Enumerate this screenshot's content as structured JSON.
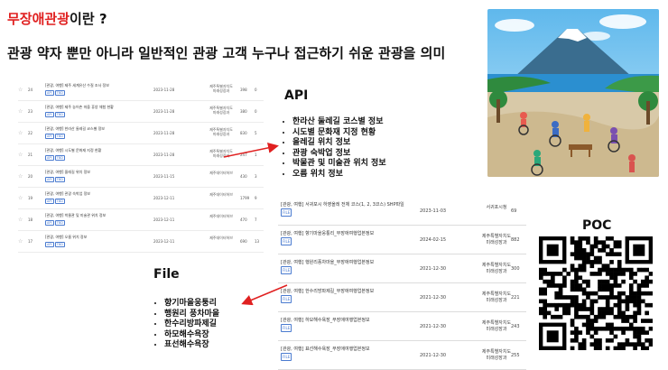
{
  "heading": {
    "highlight": "무장애관광",
    "rest": "이란 ?"
  },
  "subtitle": "관광 약자 뿐만 아니라 일반적인 관광 고객 누구나 접근하기 쉬운 관광을 의미",
  "api_label": "API",
  "api_items": [
    "한라산 둘레길 코스별 정보",
    "시도별 문화재 지정 현황",
    "올레길 위치 정보",
    "관광 숙박업 정보",
    "박물관 및 미술관 위치 정보",
    "오름 위치 정보"
  ],
  "file_label": "File",
  "file_items": [
    "향기마을웅퉁리",
    "행원리 풍차마을",
    "한수리방파제길",
    "하모해수욕장",
    "표선해수욕장"
  ],
  "poc_label": "POC",
  "api_table": [
    {
      "num": "24",
      "title": "[관광, 여행] 제주 세계유산 수질 조사 정보",
      "tags": [
        "API",
        "TBD"
      ],
      "date": "2023-11-28",
      "org1": "제주특별자치도",
      "org2": "미래성장과",
      "count": "398",
      "zero": "0"
    },
    {
      "num": "23",
      "title": "[관광, 여행] 제주 농어촌 마을 휴양 체험 현황",
      "tags": [
        "API",
        "TBD"
      ],
      "date": "2023-11-28",
      "org1": "제주특별자치도",
      "org2": "미래성장과",
      "count": "380",
      "zero": "0"
    },
    {
      "num": "22",
      "title": "[관광, 여행] 한라산 둘레길 코스별 정보",
      "tags": [
        "API",
        "TBD"
      ],
      "date": "2023-11-28",
      "org1": "제주특별자치도",
      "org2": "미래성장과",
      "count": "830",
      "zero": "5"
    },
    {
      "num": "21",
      "title": "[관광, 여행] 시도별 문화재 지정 현황",
      "tags": [
        "API",
        "TBD"
      ],
      "date": "2023-11-28",
      "org1": "제주특별자치도",
      "org2": "미래성장과",
      "count": "247",
      "zero": "1"
    },
    {
      "num": "20",
      "title": "[관광, 여행] 올레길 위치 정보",
      "tags": [
        "API",
        "TBD"
      ],
      "date": "2023-11-15",
      "org1": "제주데이터허브",
      "org2": "",
      "count": "430",
      "zero": "3"
    },
    {
      "num": "19",
      "title": "[관광, 여행] 관광 숙박업 정보",
      "tags": [
        "API",
        "TBD"
      ],
      "date": "2023-12-11",
      "org1": "제주데이터허브",
      "org2": "",
      "count": "1799",
      "zero": "9"
    },
    {
      "num": "18",
      "title": "[관광, 여행] 박물관 및 미술관 위치 정보",
      "tags": [
        "API",
        "TBD"
      ],
      "date": "2023-12-11",
      "org1": "제주데이터허브",
      "org2": "",
      "count": "470",
      "zero": "7"
    },
    {
      "num": "17",
      "title": "[관광, 여행] 오름 위치 정보",
      "tags": [
        "API",
        "TBD"
      ],
      "date": "2023-12-11",
      "org1": "제주데이터허브",
      "org2": "",
      "count": "690",
      "zero": "13"
    }
  ],
  "file_table": [
    {
      "title": "[관광, 여행] 서귀포시 하영올레 전체 코스(1, 2, 3코스) SHP파일",
      "tag": "FILE",
      "date": "2023-11-03",
      "org1": "서귀포시청",
      "org2": "",
      "count": "69"
    },
    {
      "title": "[관광, 여행] 향기마을웅퉁리_무장애여행업본정보",
      "tag": "FILE",
      "date": "2024-02-15",
      "org1": "제주특별자치도",
      "org2": "미래성장과",
      "count": "882"
    },
    {
      "title": "[관광, 여행] 행원리풍차마을_무장애여행업본정보",
      "tag": "FILE",
      "date": "2021-12-30",
      "org1": "제주특별자치도",
      "org2": "미래성장과",
      "count": "300"
    },
    {
      "title": "[관광, 여행] 한수리방파제길_무장애여행업본정보",
      "tag": "FILE",
      "date": "2021-12-30",
      "org1": "제주특별자치도",
      "org2": "미래성장과",
      "count": "221"
    },
    {
      "title": "[관광, 여행] 하모해수욕장_무장애여행업본정보",
      "tag": "FILE",
      "date": "2021-12-30",
      "org1": "제주특별자치도",
      "org2": "미래성장과",
      "count": "243"
    },
    {
      "title": "[관광, 여행] 표선해수욕장_무장애여행업본정보",
      "tag": "FILE",
      "date": "2021-12-30",
      "org1": "제주특별자치도",
      "org2": "미래성장과",
      "count": "255"
    }
  ],
  "colors": {
    "highlight": "#e02020",
    "arrow": "#e02020",
    "tag": "#4a7bd0"
  }
}
